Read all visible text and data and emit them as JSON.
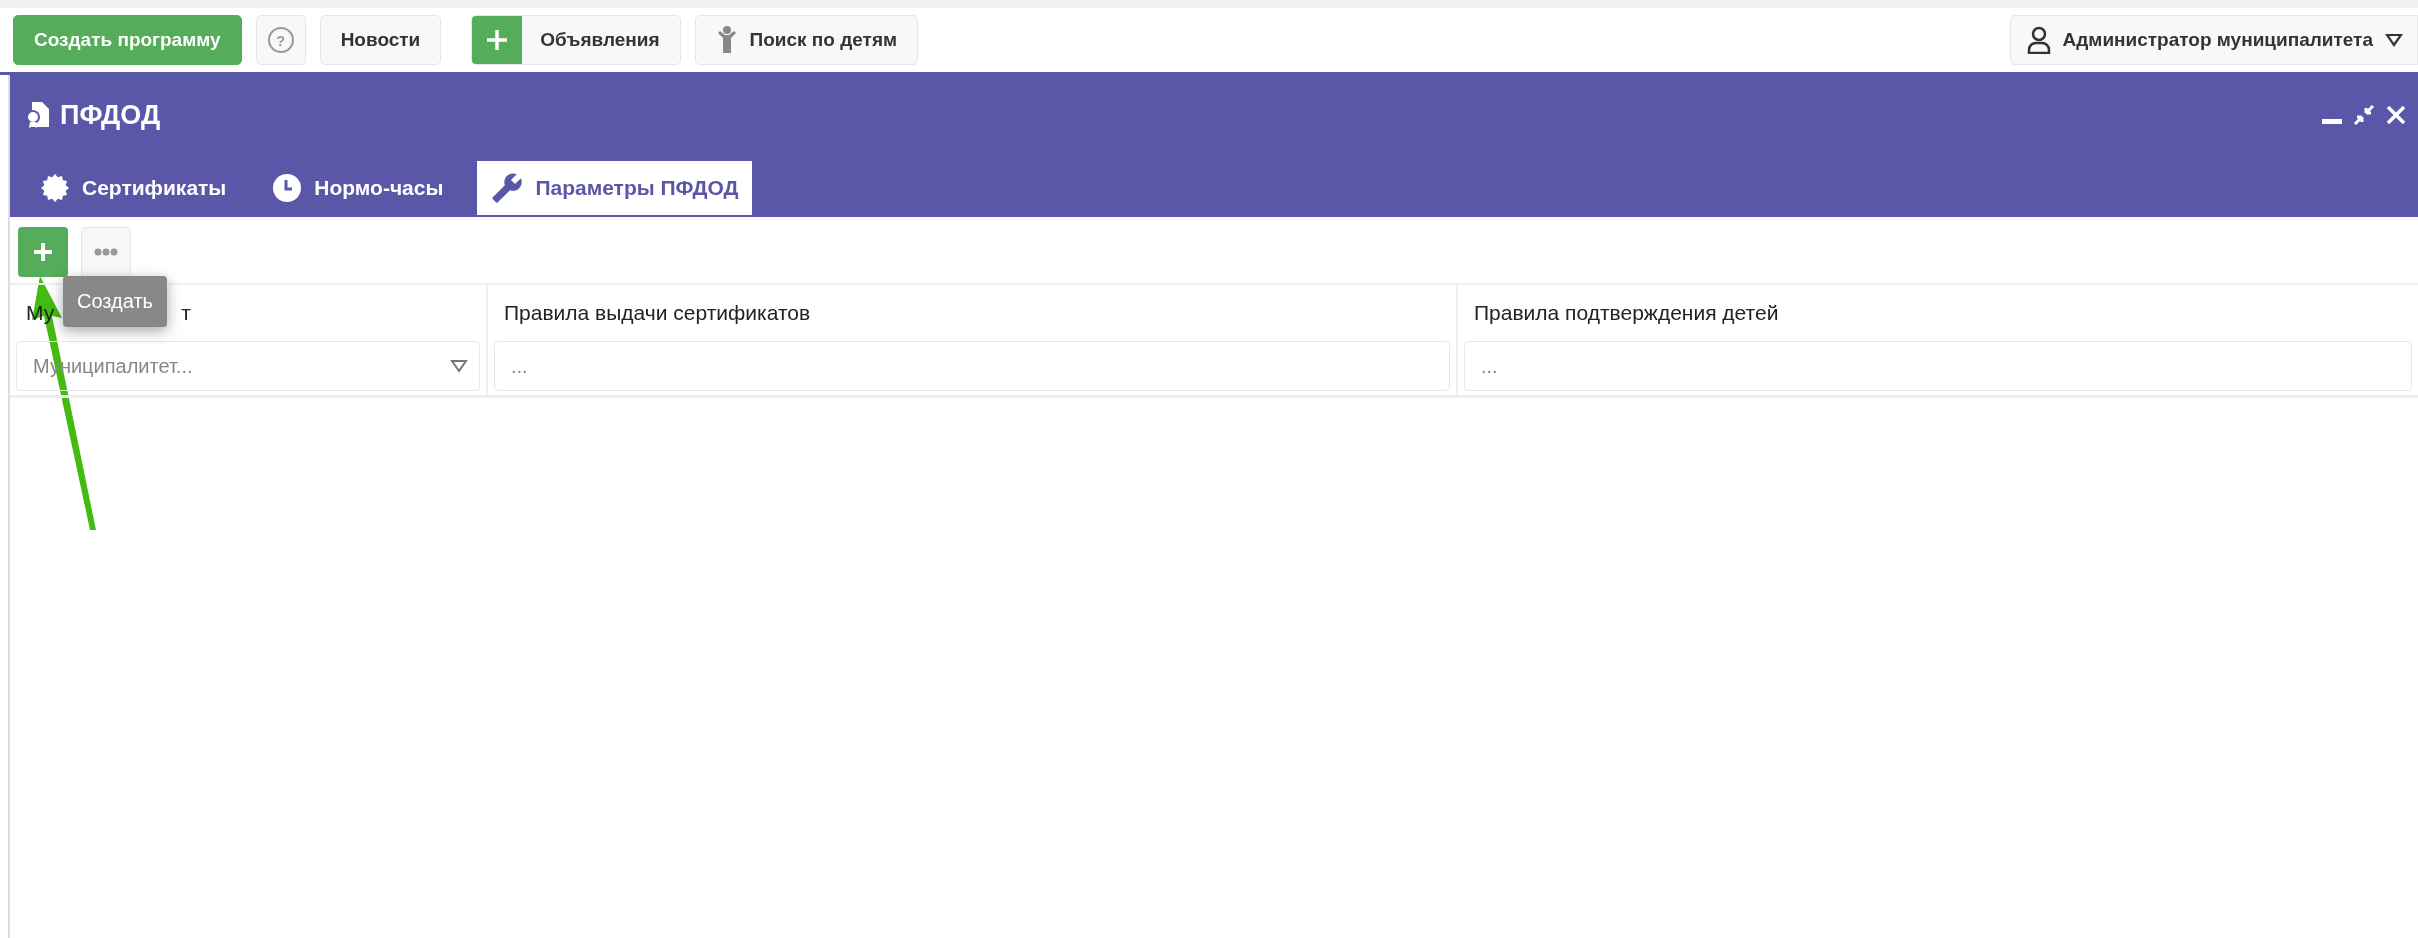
{
  "top_bar": {
    "buttons": [
      {
        "kind": "primary",
        "label": "Создать программу"
      },
      {
        "kind": "help",
        "label": "?"
      },
      {
        "kind": "plain",
        "label": "Новости"
      },
      {
        "kind": "add",
        "label": "Объявления"
      },
      {
        "kind": "child",
        "label": "Поиск по детям"
      }
    ],
    "user": {
      "label": "Администратор муниципалитета"
    }
  },
  "window": {
    "title": "ПФДОД"
  },
  "tabs": [
    {
      "label": "Сертификаты",
      "kind": "certificates",
      "selected": false
    },
    {
      "label": "Нормо-часы",
      "kind": "hours",
      "selected": false
    },
    {
      "label": "Параметры ПФДОД",
      "kind": "settings",
      "selected": true
    }
  ],
  "toolbar": {
    "tooltip": "Создать"
  },
  "table": {
    "columns": [
      {
        "label_parts": [
          "Му",
          "т"
        ],
        "kind": "select",
        "placeholder": "Муниципалитет..."
      },
      {
        "label": "Правила выдачи сертификатов",
        "kind": "text",
        "placeholder": "..."
      },
      {
        "label": "Правила подтверждения детей",
        "kind": "text",
        "placeholder": "..."
      }
    ]
  }
}
